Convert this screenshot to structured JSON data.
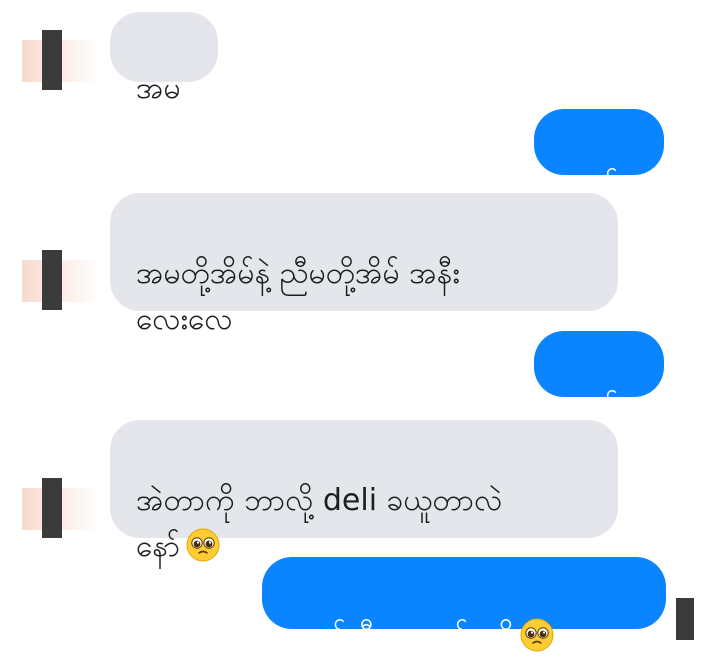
{
  "messages": [
    {
      "side": "received",
      "text": "အမ"
    },
    {
      "side": "sent",
      "text": "ဟုတ်"
    },
    {
      "side": "received",
      "text": "အမတို့အိမ်နဲ့ ညီမတို့အိမ် အနီး\nလေးလေ"
    },
    {
      "side": "sent",
      "text": "ဟုတ်"
    },
    {
      "side": "received",
      "text": "အဲတာကို ဘာလို့ deli ခယူတာလဲ\nနော်"
    },
    {
      "side": "sent",
      "text": "ဘော်လီ ထ ဝတ်ရလို့"
    }
  ],
  "colors": {
    "received_bubble": "#e4e6eb",
    "sent_bubble": "#0a84ff"
  },
  "icons": {
    "emoji": "pleading-face-emoji"
  }
}
